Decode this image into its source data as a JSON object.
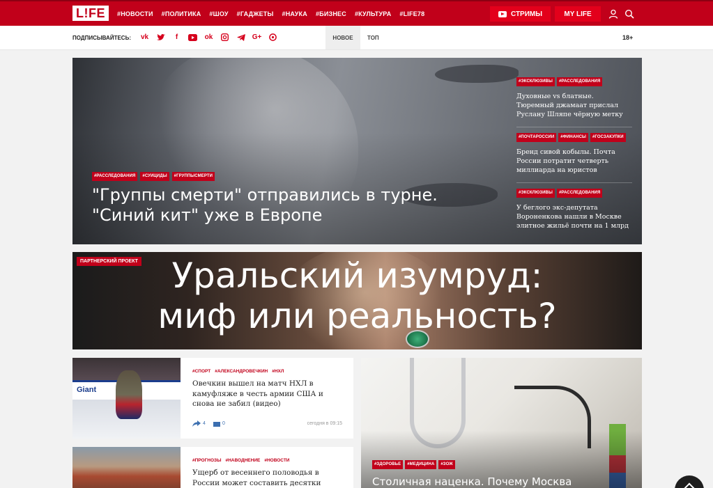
{
  "header": {
    "logo": "L!FE",
    "nav": [
      "#НОВОСТИ",
      "#ПОЛИТИКА",
      "#ШОУ",
      "#ГАДЖЕТЫ",
      "#НАУКА",
      "#БИЗНЕС",
      "#КУЛЬТУРА",
      "#LIFE78"
    ],
    "streams_label": "СТРИМЫ",
    "mylife_label": "MY LIFE",
    "icons": [
      "user-icon",
      "search-icon"
    ]
  },
  "subbar": {
    "subscribe_label": "ПОДПИСЫВАЙТЕСЬ:",
    "socials": [
      "vk",
      "twitter",
      "facebook",
      "youtube",
      "odnoklassniki",
      "instagram",
      "telegram",
      "google-plus",
      "viber"
    ],
    "tab_new": "НОВОЕ",
    "tab_top": "ТОП",
    "age": "18+"
  },
  "hero": {
    "tags": [
      "#РАССЛЕДОВАНИЯ",
      "#СУИЦИДЫ",
      "#ГРУППЫСМЕРТИ"
    ],
    "title": "\"Группы смерти\" отправились в турне. \"Синий кит\" уже в Европе"
  },
  "side_news": [
    {
      "tags": [
        "#ЭКСКЛЮЗИВЫ",
        "#РАССЛЕДОВАНИЯ"
      ],
      "text": "Духовные vs блатные. Тюремный джамаат прислал Руслану Шляпе чёрную метку"
    },
    {
      "tags": [
        "#ПОЧТАРОССИИ",
        "#ФИНАНСЫ",
        "#ГОСЗАКУПКИ"
      ],
      "text": "Бренд сивой кобылы. Почта России потратит четверть миллиарда на юристов"
    },
    {
      "tags": [
        "#ЭКСКЛЮЗИВЫ",
        "#РАССЛЕДОВАНИЯ"
      ],
      "text": "У беглого экс-депутата Вороненкова нашли в Москве элитное жильё почти на 1 млрд"
    }
  ],
  "partner": {
    "badge": "ПАРТНЕРСКИЙ ПРОЕКТ",
    "title_line1": "Уральский изумруд:",
    "title_line2": "миф или реальность?"
  },
  "cards": [
    {
      "tags": [
        "#СПОРТ",
        "#АЛЕКСАНДРОВЕЧКИН",
        "#НХЛ"
      ],
      "title": "Овечкин вышел на матч НХЛ в камуфляже в честь армии США и снова не забил (видео)",
      "shares": "4",
      "comments": "0",
      "time": "сегодня в 09:15",
      "board_text": "Giant"
    },
    {
      "tags": [
        "#ПРОГНОЗЫ",
        "#НАВОДНЕНИЕ",
        "#НОВОСТИ"
      ],
      "title": "Ущерб от весеннего половодья в России может составить десятки"
    }
  ],
  "big_card": {
    "tags": [
      "#ЗДОРОВЬЕ",
      "#МЕДИЦИНА",
      "#ЗОЖ"
    ],
    "title": "Столичная наценка. Почему Москва"
  },
  "colors": {
    "brand": "#c1001a",
    "accent": "#e3001b",
    "link": "#3c6fb0"
  }
}
